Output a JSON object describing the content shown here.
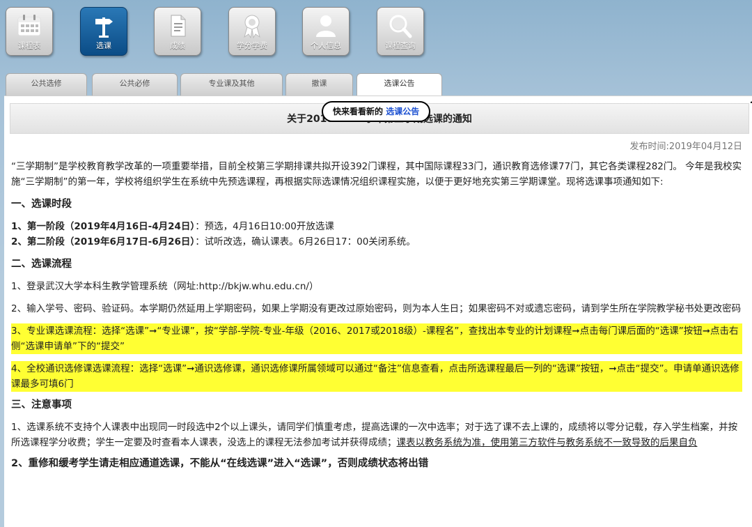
{
  "toolbar": {
    "buttons": [
      {
        "label": "课程表",
        "icon": "calendar-icon"
      },
      {
        "label": "选课",
        "icon": "signpost-icon"
      },
      {
        "label": "成绩",
        "icon": "document-icon"
      },
      {
        "label": "学分学费",
        "icon": "award-icon"
      },
      {
        "label": "个人信息",
        "icon": "person-icon"
      },
      {
        "label": "课程查询",
        "icon": "magnifier-icon"
      }
    ]
  },
  "tabs": [
    "公共选修",
    "公共必修",
    "专业课及其他",
    "撤课",
    "选课公告"
  ],
  "callout": {
    "prefix": "快来看看新的",
    "highlight": "选课公告"
  },
  "notice": {
    "title": "关于2018-2019学年第三学期选课的通知",
    "pubdate": "发布时间:2019年04月12日",
    "intro": "“三学期制”是学校教育教学改革的一项重要举措，目前全校第三学期排课共拟开设392门课程，其中国际课程33门，通识教育选修课77门，其它各类课程282门。 今年是我校实施“三学期制”的第一年，学校将组织学生在系统中先预选课程，再根据实际选课情况组织课程实施，以便于更好地充实第三学期课堂。现将选课事项通知如下:",
    "section1": "一、选课时段",
    "s1_1_bold": "1、第一阶段（2019年4月16日-4月24日）",
    "s1_1_rest": "：预选，4月16日10:00开放选课",
    "s1_2_bold": "2、第二阶段（2019年6月17日-6月26日）",
    "s1_2_rest": "：试听改选，确认课表。6月26日17：00关闭系统。",
    "section2": "二、选课流程",
    "s2_1_a": "1、登录武汉大学本科生教学管理系统（网址:",
    "s2_1_link": "http://bkjw.whu.edu.cn/",
    "s2_1_b": "）",
    "s2_2": "2、输入学号、密码、验证码。本学期仍然延用上学期密码，如果上学期没有更改过原始密码，则为本人生日；如果密码不对或遗忘密码，请到学生所在学院教学秘书处更改密码",
    "s2_3": "3、专业课选课流程：选择“选课”➞“专业课”，按“学部-学院-专业-年级（2016、2017或2018级）-课程名”，查找出本专业的计划课程➞点击每门课后面的“选课”按钮➞点击右侧“选课申请单”下的“提交”",
    "s2_4": "4、全校通识选修课选课流程：选择“选课”➞通识选修课，通识选修课所属领域可以通过“备注”信息查看，点击所选课程最后一列的“选课”按钮，➞点击“提交”。申请单通识选修课最多可填6门",
    "section3": "三、注意事项",
    "s3_1_a": "1、选课系统不支持个人课表中出现同一时段选中2个以上课头，请同学们慎重考虑，提高选课的一次中选率；对于选了课不去上课的，成绩将以零分记载，存入学生档案，并按所选课程学分收费；学生一定要及时查看本人课表，没选上的课程无法参加考试并获得成绩；",
    "s3_1_u": "课表以教务系统为准，使用第三方软件与教务系统不一致导致的后果自负",
    "s3_2": "2、重修和缓考学生请走相应通道选课，不能从“在线选课”进入“选课”，否则成绩状态将出错"
  }
}
